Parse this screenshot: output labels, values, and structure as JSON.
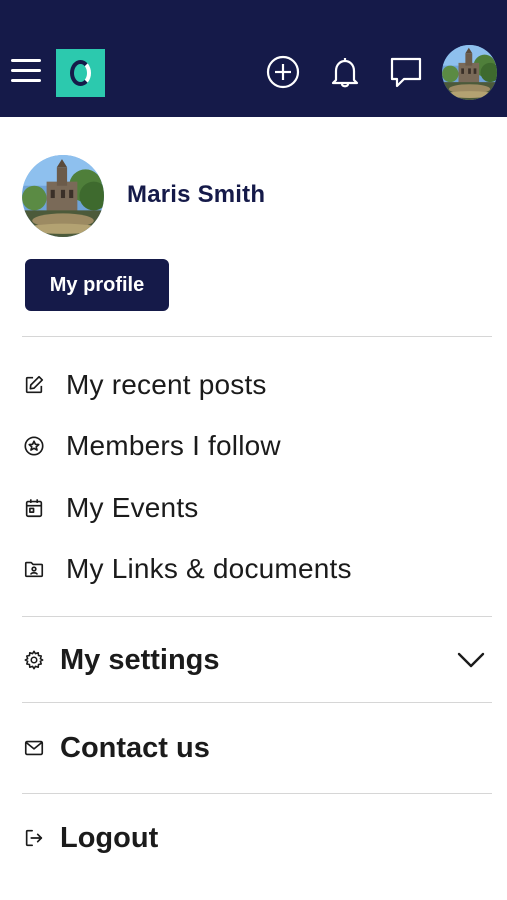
{
  "header": {
    "menu_icon": "hamburger-menu-icon",
    "logo_icon": "app-logo",
    "actions": [
      {
        "name": "add-post-icon"
      },
      {
        "name": "notifications-bell-icon"
      },
      {
        "name": "messages-icon"
      }
    ],
    "colors": {
      "background": "#151a49",
      "logo": "#2cc9ae"
    }
  },
  "profile": {
    "name": "Maris Smith",
    "button_label": "My profile"
  },
  "menu": {
    "items": [
      {
        "label": "My recent posts",
        "icon": "edit-pencil-icon"
      },
      {
        "label": "Members I follow",
        "icon": "star-circle-icon"
      },
      {
        "label": "My Events",
        "icon": "calendar-icon"
      },
      {
        "label": "My Links & documents",
        "icon": "folder-person-icon"
      }
    ]
  },
  "sections": {
    "settings": {
      "label": "My settings",
      "icon": "gear-icon",
      "toggle_icon": "chevron-down-icon"
    },
    "contact": {
      "label": "Contact us",
      "icon": "envelope-icon"
    },
    "logout": {
      "label": "Logout",
      "icon": "logout-icon"
    }
  }
}
